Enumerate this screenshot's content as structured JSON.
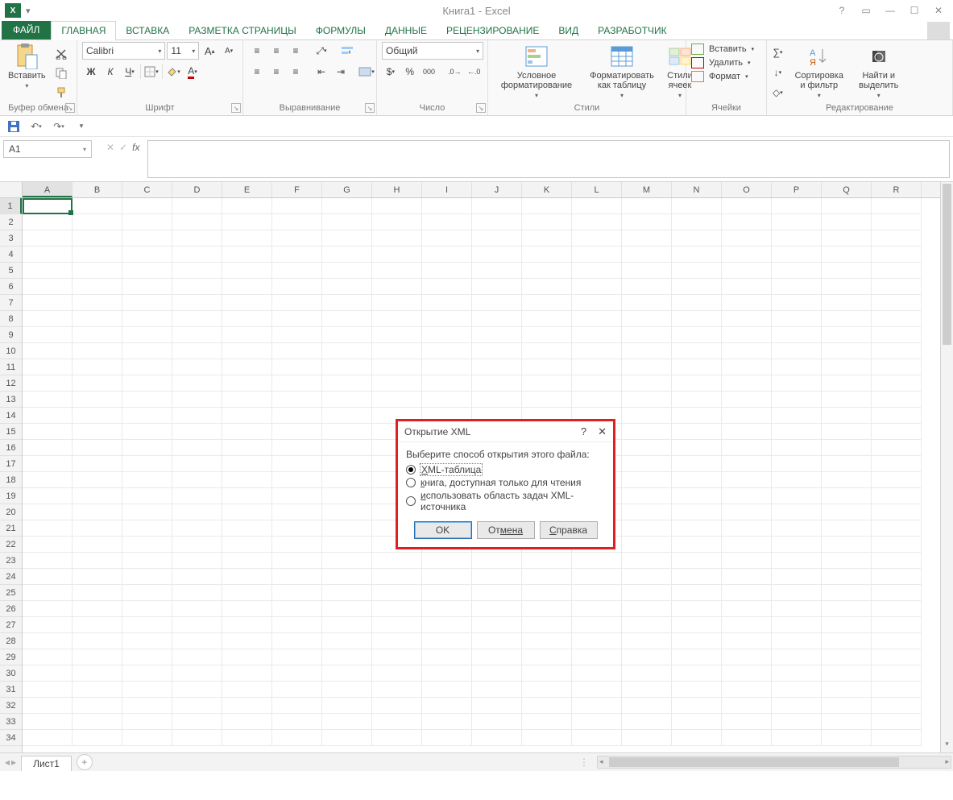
{
  "title": "Книга1 - Excel",
  "tabs": {
    "file": "ФАЙЛ",
    "items": [
      "ГЛАВНАЯ",
      "ВСТАВКА",
      "РАЗМЕТКА СТРАНИЦЫ",
      "ФОРМУЛЫ",
      "ДАННЫЕ",
      "РЕЦЕНЗИРОВАНИЕ",
      "ВИД",
      "РАЗРАБОТЧИК"
    ],
    "active": 0
  },
  "ribbon": {
    "clipboard": {
      "paste": "Вставить",
      "label": "Буфер обмена"
    },
    "font": {
      "name": "Calibri",
      "size": "11",
      "label": "Шрифт"
    },
    "align": {
      "label": "Выравнивание"
    },
    "number": {
      "format": "Общий",
      "label": "Число"
    },
    "styles": {
      "cond": "Условное форматирование",
      "table": "Форматировать как таблицу",
      "cell": "Стили ячеек",
      "label": "Стили"
    },
    "cells": {
      "insert": "Вставить",
      "delete": "Удалить",
      "format": "Формат",
      "label": "Ячейки"
    },
    "editing": {
      "sort": "Сортировка и фильтр",
      "find": "Найти и выделить",
      "label": "Редактирование"
    }
  },
  "namebox": "A1",
  "columns": [
    "A",
    "B",
    "C",
    "D",
    "E",
    "F",
    "G",
    "H",
    "I",
    "J",
    "K",
    "L",
    "M",
    "N",
    "O",
    "P",
    "Q",
    "R"
  ],
  "rows": 34,
  "sheet": {
    "name": "Лист1"
  },
  "dialog": {
    "title": "Открытие XML",
    "prompt": "Выберите способ открытия этого файла:",
    "opt1_pre": "X",
    "opt1_rest": "ML-таблица",
    "opt2_pre": "к",
    "opt2_rest": "нига, доступная только для чтения",
    "opt3_pre": "и",
    "opt3_rest": "спользовать область задач XML-источника",
    "ok": "OK",
    "cancel_pre": "От",
    "cancel_rest": "мена",
    "help_pre": "С",
    "help_rest": "правка"
  }
}
